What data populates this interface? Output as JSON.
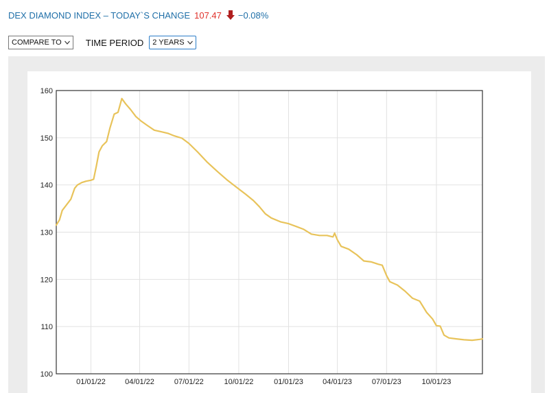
{
  "header": {
    "title": "DEX DIAMOND INDEX – TODAY`S CHANGE",
    "value": "107.47",
    "change": "−0.08%",
    "arrow_icon": "down-arrow-icon",
    "colors": {
      "title": "#1f6fa8",
      "value": "#e0312a",
      "arrow": "#b01f1f"
    }
  },
  "controls": {
    "compare_label": "COMPARE TO",
    "period_label": "TIME PERIOD",
    "period_value": "2 YEARS"
  },
  "chart_data": {
    "type": "line",
    "title": "",
    "xlabel": "",
    "ylabel": "",
    "ylim": [
      100,
      160
    ],
    "yticks": [
      100,
      110,
      120,
      130,
      140,
      150,
      160
    ],
    "x_range": [
      "2021-10-29",
      "2023-12-25"
    ],
    "xticks": [
      "2022-01-01",
      "2022-04-01",
      "2022-07-01",
      "2022-10-01",
      "2023-01-01",
      "2023-04-01",
      "2023-07-01",
      "2023-10-01"
    ],
    "xtick_labels": [
      "01/01/22",
      "04/01/22",
      "07/01/22",
      "10/01/22",
      "01/01/23",
      "04/01/23",
      "07/01/23",
      "10/01/23"
    ],
    "grid": true,
    "line_color": "#e8c35a",
    "series": [
      {
        "points": [
          [
            "2021-10-29",
            131.5
          ],
          [
            "2021-11-04",
            132.6
          ],
          [
            "2021-11-09",
            134.6
          ],
          [
            "2021-11-17",
            135.8
          ],
          [
            "2021-11-25",
            137.0
          ],
          [
            "2021-12-02",
            139.3
          ],
          [
            "2021-12-07",
            140.0
          ],
          [
            "2021-12-15",
            140.5
          ],
          [
            "2021-12-23",
            140.8
          ],
          [
            "2022-01-01",
            141.0
          ],
          [
            "2022-01-06",
            141.2
          ],
          [
            "2022-01-11",
            144.0
          ],
          [
            "2022-01-16",
            147.0
          ],
          [
            "2022-01-22",
            148.3
          ],
          [
            "2022-01-30",
            149.2
          ],
          [
            "2022-02-05",
            152.0
          ],
          [
            "2022-02-13",
            155.0
          ],
          [
            "2022-02-20",
            155.4
          ],
          [
            "2022-02-27",
            158.3
          ],
          [
            "2022-03-06",
            157.2
          ],
          [
            "2022-03-15",
            156.0
          ],
          [
            "2022-03-25",
            154.5
          ],
          [
            "2022-04-03",
            153.6
          ],
          [
            "2022-04-15",
            152.6
          ],
          [
            "2022-04-28",
            151.6
          ],
          [
            "2022-05-10",
            151.3
          ],
          [
            "2022-05-24",
            150.9
          ],
          [
            "2022-06-04",
            150.4
          ],
          [
            "2022-06-18",
            149.9
          ],
          [
            "2022-07-01",
            148.8
          ],
          [
            "2022-07-17",
            147.0
          ],
          [
            "2022-08-03",
            144.9
          ],
          [
            "2022-08-22",
            142.9
          ],
          [
            "2022-09-09",
            141.1
          ],
          [
            "2022-09-28",
            139.4
          ],
          [
            "2022-10-14",
            138.0
          ],
          [
            "2022-10-28",
            136.7
          ],
          [
            "2022-11-08",
            135.4
          ],
          [
            "2022-11-19",
            133.9
          ],
          [
            "2022-11-30",
            133.0
          ],
          [
            "2022-12-17",
            132.2
          ],
          [
            "2023-01-01",
            131.8
          ],
          [
            "2023-01-15",
            131.2
          ],
          [
            "2023-01-29",
            130.6
          ],
          [
            "2023-02-12",
            129.6
          ],
          [
            "2023-02-27",
            129.3
          ],
          [
            "2023-03-13",
            129.3
          ],
          [
            "2023-03-24",
            129.0
          ],
          [
            "2023-03-27",
            129.8
          ],
          [
            "2023-04-01",
            128.4
          ],
          [
            "2023-04-08",
            127.0
          ],
          [
            "2023-04-22",
            126.4
          ],
          [
            "2023-05-07",
            125.2
          ],
          [
            "2023-05-20",
            123.9
          ],
          [
            "2023-06-03",
            123.7
          ],
          [
            "2023-06-16",
            123.2
          ],
          [
            "2023-06-23",
            123.0
          ],
          [
            "2023-07-01",
            120.8
          ],
          [
            "2023-07-07",
            119.5
          ],
          [
            "2023-07-21",
            118.8
          ],
          [
            "2023-08-04",
            117.5
          ],
          [
            "2023-08-18",
            116.0
          ],
          [
            "2023-08-31",
            115.4
          ],
          [
            "2023-09-13",
            113.0
          ],
          [
            "2023-09-24",
            111.6
          ],
          [
            "2023-10-01",
            110.2
          ],
          [
            "2023-10-08",
            110.1
          ],
          [
            "2023-10-15",
            108.2
          ],
          [
            "2023-10-24",
            107.6
          ],
          [
            "2023-11-07",
            107.4
          ],
          [
            "2023-11-21",
            107.2
          ],
          [
            "2023-12-06",
            107.1
          ],
          [
            "2023-12-20",
            107.3
          ],
          [
            "2023-12-25",
            107.4
          ]
        ]
      }
    ]
  }
}
